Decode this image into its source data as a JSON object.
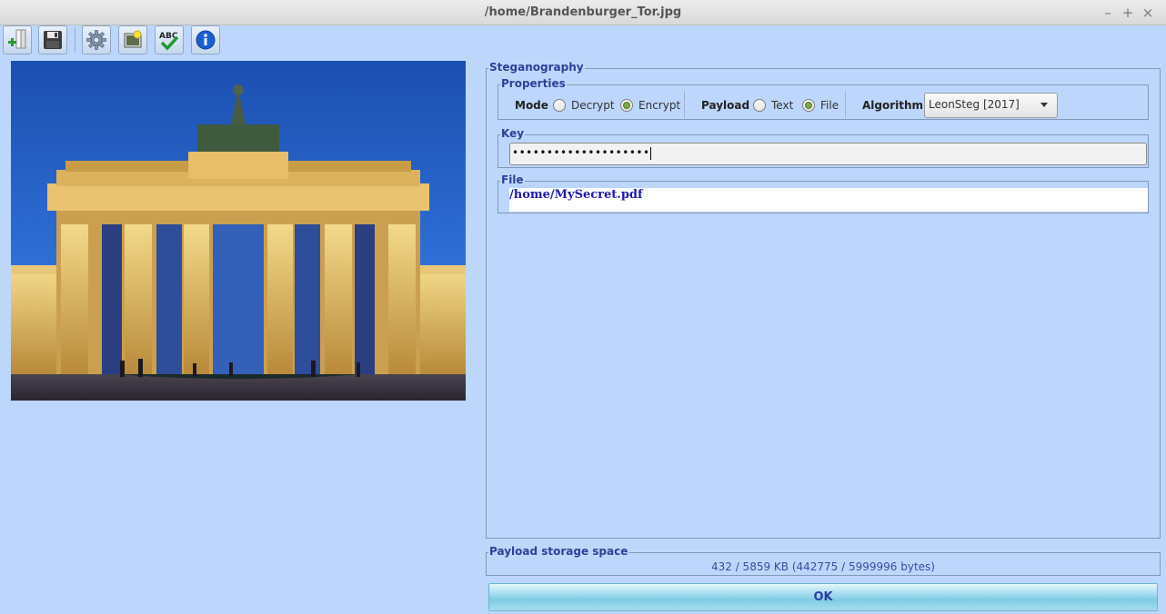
{
  "window": {
    "title": "/home/Brandenburger_Tor.jpg",
    "minimize": "–",
    "maximize": "+",
    "close": "×"
  },
  "toolbar": {
    "buttons": [
      {
        "icon": "open-file-icon"
      },
      {
        "icon": "save-icon"
      },
      {
        "icon": "settings-gear-icon"
      },
      {
        "icon": "new-image-icon"
      },
      {
        "icon": "spellcheck-icon"
      },
      {
        "icon": "info-icon"
      }
    ]
  },
  "steganography": {
    "title": "Steganography",
    "properties": {
      "title": "Properties",
      "mode_label": "Mode",
      "mode_options": [
        "Decrypt",
        "Encrypt"
      ],
      "mode_selected": "Encrypt",
      "payload_label": "Payload",
      "payload_options": [
        "Text",
        "File"
      ],
      "payload_selected": "File",
      "algorithm_label": "Algorithm",
      "algorithm_value": "LeonSteg [2017]"
    },
    "key": {
      "title": "Key",
      "value": "••••••••••••••••••••"
    },
    "file": {
      "title": "File",
      "path": "/home/MySecret.pdf"
    }
  },
  "storage": {
    "title": "Payload storage space",
    "text": "432 / 5859 KB  (442775 / 5999996 bytes)"
  },
  "ok_label": "OK"
}
